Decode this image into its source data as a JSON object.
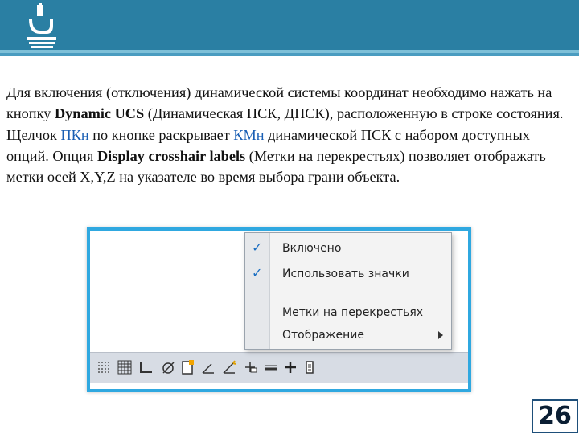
{
  "paragraph": {
    "p1": "Для включения (отключения) динамической системы координат необходимо нажать на кнопку ",
    "b1": "Dynamic UCS",
    "p2": " (Динамическая ПСК, ДПСК), расположенную в строке состояния. Щелчок ",
    "u1": "ПКн",
    "p3": " по кнопке раскрывает ",
    "u2": "КМн",
    "p4": " динамической ПСК с набором доступных опций. Опция ",
    "b2": "Display crosshair labels",
    "p5": " (Метки на перекрестьях) позволяет отображать метки осей X,Y,Z на указателе во время выбора грани объекта."
  },
  "context_menu": {
    "items": [
      {
        "label": "Включено",
        "checked": true
      },
      {
        "label": "Использовать значки",
        "checked": true
      },
      {
        "label": "Метки на перекрестьях",
        "checked": false
      },
      {
        "label": "Отображение",
        "checked": false,
        "submenu": true
      }
    ]
  },
  "status_bar": {
    "icons": [
      "snap-icon",
      "grid-icon",
      "ortho-icon",
      "polar-icon",
      "osnap-icon",
      "otrack-icon",
      "dynamic-ucs-icon",
      "dynamic-input-icon",
      "lineweight-icon",
      "transparency-icon",
      "quick-properties-icon"
    ]
  },
  "colors": {
    "header": "#2a7fa3",
    "accent": "#2fa8e0",
    "check": "#1c6fc2"
  },
  "slide_number": "26"
}
